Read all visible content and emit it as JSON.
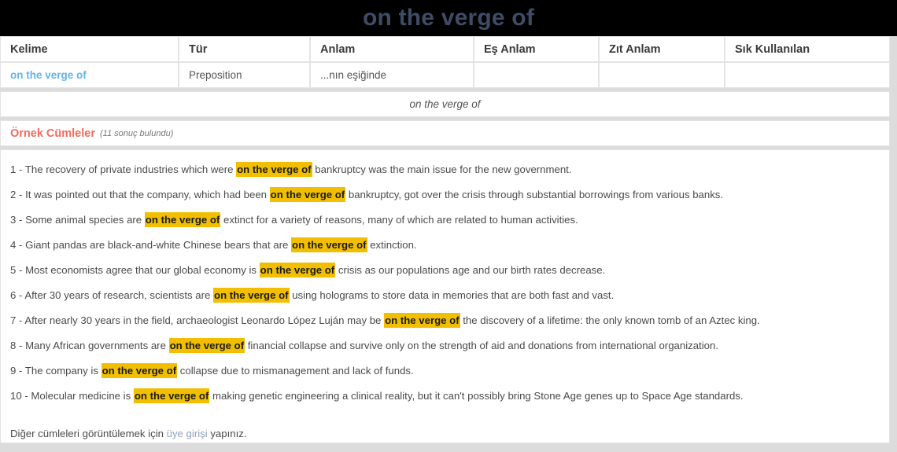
{
  "header": {
    "title": "on the verge of",
    "title_color": "#3f4c66",
    "background_color": "#000000"
  },
  "word_table": {
    "columns": [
      "Kelime",
      "Tür",
      "Anlam",
      "Eş Anlam",
      "Zıt Anlam",
      "Sık Kullanılan"
    ],
    "rows": [
      {
        "kelime": "on the verge of",
        "tur": "Preposition",
        "anlam": "...nın eşiğinde",
        "es_anlam": "",
        "zit_anlam": "",
        "sik_kullanilan": ""
      }
    ],
    "link_color": "#62b4e8"
  },
  "phrase_strip": {
    "text": "on the verge of"
  },
  "examples": {
    "title": "Örnek Cümleler",
    "title_color": "#f26a5e",
    "count_text": "(11 sonuç bulundu)",
    "highlight_color": "#f2bf00",
    "highlight_term": "on the verge of",
    "sentences": [
      {
        "number": "1 - ",
        "before": "The recovery of private industries which were ",
        "highlight": "on the verge of",
        "after": " bankruptcy was the main issue for the new government."
      },
      {
        "number": "2 - ",
        "before": "It was pointed out that the company, which had been ",
        "highlight": "on the verge of",
        "after": " bankruptcy, got over the crisis through substantial borrowings from various banks."
      },
      {
        "number": "3 - ",
        "before": "Some animal species are ",
        "highlight": "on the verge of",
        "after": " extinct for a variety of reasons, many of which are related to human activities."
      },
      {
        "number": "4 - ",
        "before": "Giant pandas are black-and-white Chinese bears that are ",
        "highlight": "on the verge of",
        "after": " extinction."
      },
      {
        "number": "5 - ",
        "before": "Most economists agree that our global economy is ",
        "highlight": "on the verge of",
        "after": " crisis as our populations age and our birth rates decrease."
      },
      {
        "number": "6 - ",
        "before": "After 30 years of research, scientists are ",
        "highlight": "on the verge of",
        "after": " using holograms to store data in memories that are both fast and vast."
      },
      {
        "number": "7 - ",
        "before": "After nearly 30 years in the field, archaeologist Leonardo López Luján may be ",
        "highlight": "on the verge of",
        "after": " the discovery of a lifetime: the only known tomb of an Aztec king."
      },
      {
        "number": "8 - ",
        "before": "Many African governments are ",
        "highlight": "on the verge of",
        "after": " financial collapse and survive only on the strength of aid and donations from international organization."
      },
      {
        "number": "9 - ",
        "before": "The company is ",
        "highlight": "on the verge of",
        "after": " collapse due to mismanagement and lack of funds."
      },
      {
        "number": "10 - ",
        "before": "Molecular medicine is ",
        "highlight": "on the verge of",
        "after": " making genetic engineering a clinical reality, but it can't possibly bring Stone Age genes up to Space Age standards."
      }
    ],
    "footnote": {
      "before": "Diğer cümleleri görüntülemek için ",
      "link": "üye girişi",
      "after": " yapınız."
    }
  }
}
